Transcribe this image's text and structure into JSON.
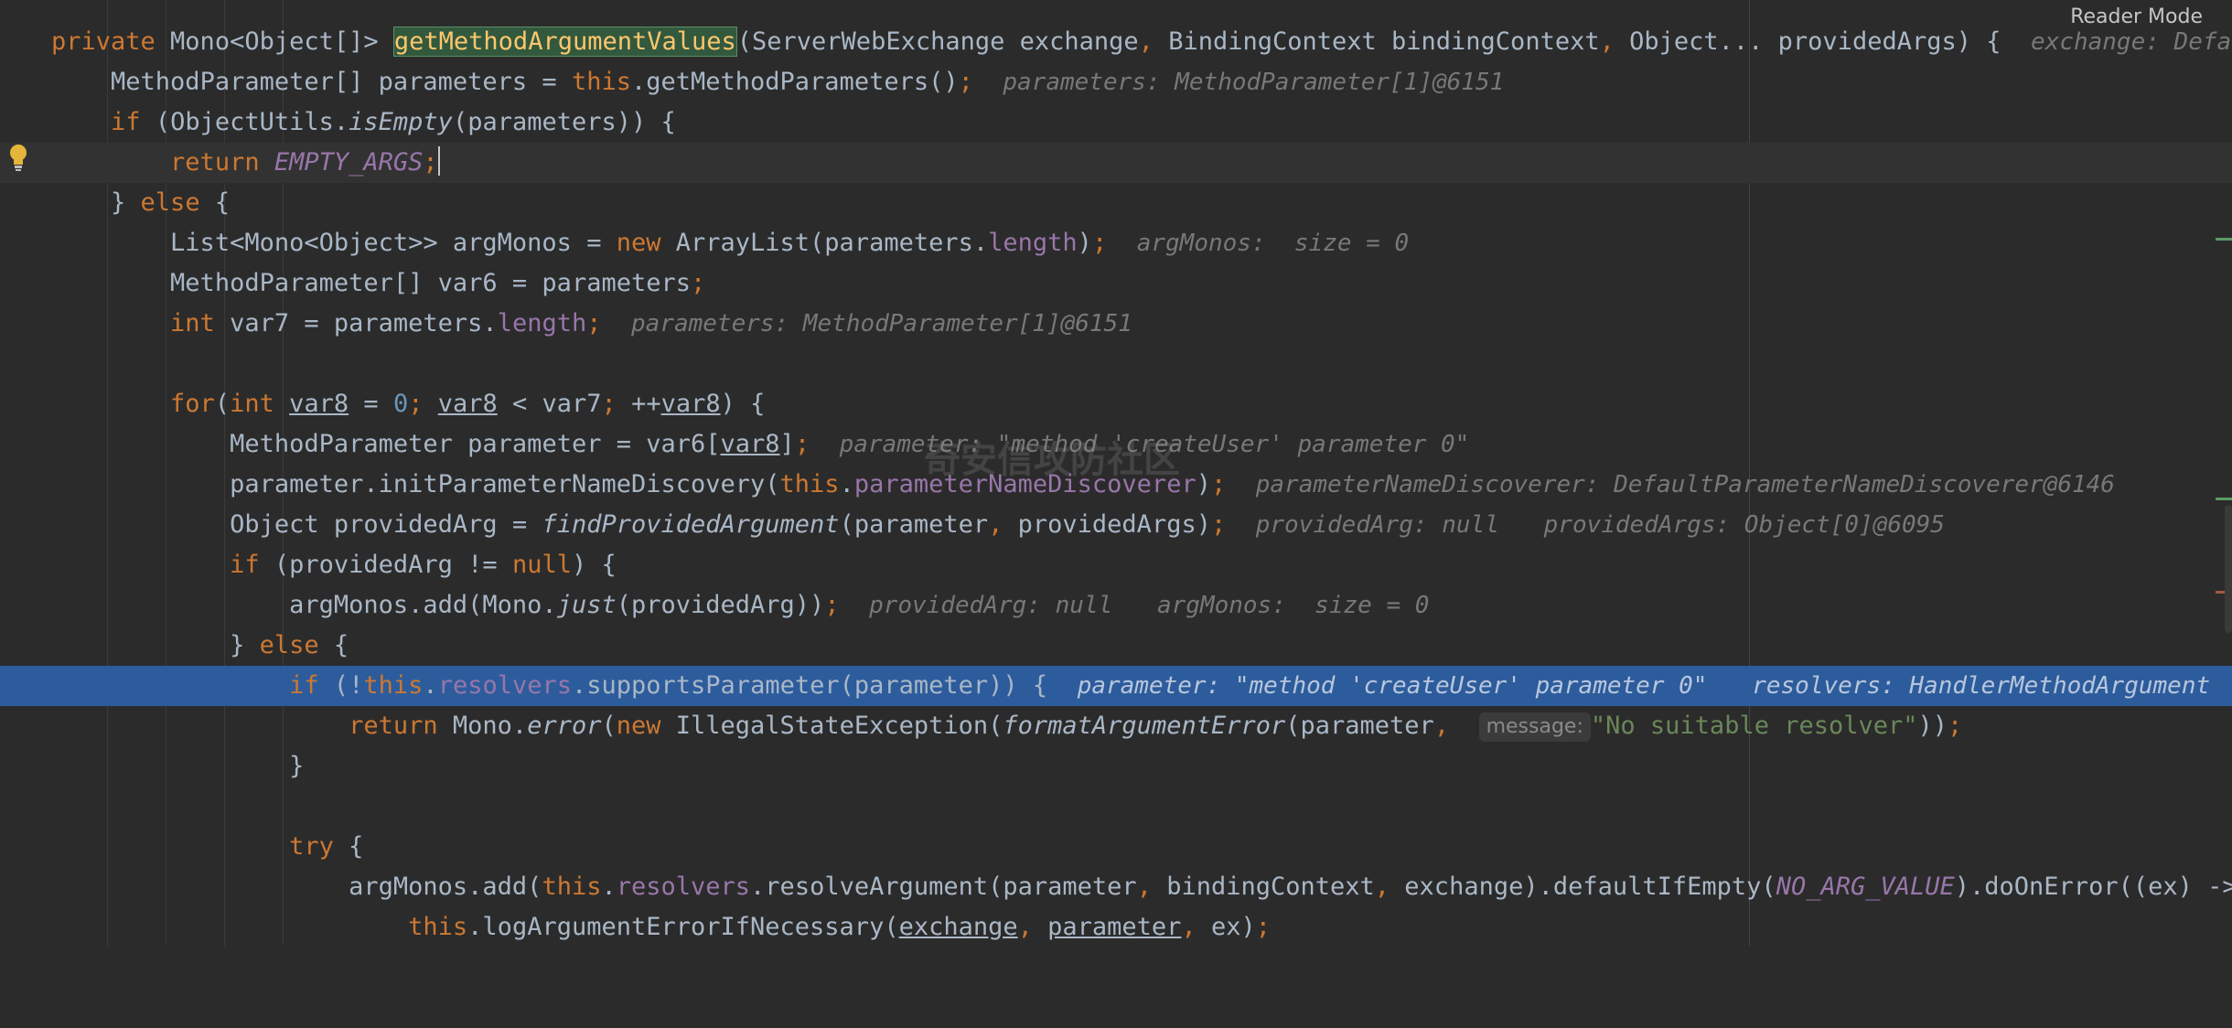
{
  "reader_mode_label": "Reader Mode",
  "watermark_text": "奇安信攻防社区",
  "colors": {
    "keyword": "#cc7832",
    "method_decl": "#ffc66d",
    "field": "#9876aa",
    "number": "#6897bb",
    "string": "#6a8759",
    "execution_line": "#2d5c9c",
    "hint": "#787878"
  },
  "l1": {
    "a": "private ",
    "b": "Mono<Object[]> ",
    "c": "getMethodArgumentValues",
    "d": "(ServerWebExchange exchange",
    "e": ", ",
    "f": "BindingContext bindingContext",
    "g": ", ",
    "h": "Object... providedArgs) {",
    "hint": "exchange: Default"
  },
  "l2": {
    "a": "MethodParameter[] parameters = ",
    "b": "this",
    "c": ".getMethodParameters()",
    "d": ";",
    "hint": "parameters: MethodParameter[1]@6151"
  },
  "l3": {
    "a": "if ",
    "b": "(ObjectUtils.",
    "c": "isEmpty",
    "d": "(parameters)) {"
  },
  "l4": {
    "a": "return ",
    "b": "EMPTY_ARGS",
    "c": ";"
  },
  "l5": {
    "a": "} ",
    "b": "else ",
    "c": "{"
  },
  "l6": {
    "a": "List<Mono<Object>> argMonos = ",
    "b": "new ",
    "c": "ArrayList(parameters.",
    "d": "length",
    "e": ")",
    "f": ";",
    "hint": "argMonos:  size = 0"
  },
  "l7": {
    "a": "MethodParameter[] var6 = parameters",
    "b": ";"
  },
  "l8": {
    "a": "int ",
    "b": "var7 = parameters.",
    "c": "length",
    "d": ";",
    "hint": "parameters: MethodParameter[1]@6151"
  },
  "l10": {
    "a": "for",
    "b": "(",
    "c": "int ",
    "d": "var8",
    "e": " = ",
    "f": "0",
    "g": "; ",
    "h": "var8",
    "i": " < var7",
    "j": "; ",
    "k": "++",
    "l": "var8",
    "m": ") {"
  },
  "l11": {
    "a": "MethodParameter parameter = var6[",
    "b": "var8",
    "c": "]",
    "d": ";",
    "hint": "parameter: \"method 'createUser' parameter 0\""
  },
  "l12": {
    "a": "parameter.initParameterNameDiscovery(",
    "b": "this",
    "c": ".",
    "d": "parameterNameDiscoverer",
    "e": ")",
    "f": ";",
    "hint": "parameterNameDiscoverer: DefaultParameterNameDiscoverer@6146"
  },
  "l13": {
    "a": "Object providedArg = ",
    "b": "findProvidedArgument",
    "c": "(parameter",
    "d": ", ",
    "e": "providedArgs)",
    "f": ";",
    "hint1": "providedArg: null",
    "hint2": "providedArgs: Object[0]@6095"
  },
  "l14": {
    "a": "if ",
    "b": "(providedArg != ",
    "c": "null",
    "d": ") {"
  },
  "l15": {
    "a": "argMonos.add(Mono.",
    "b": "just",
    "c": "(providedArg))",
    "d": ";",
    "hint1": "providedArg: null",
    "hint2": "argMonos:  size = 0"
  },
  "l16": {
    "a": "} ",
    "b": "else ",
    "c": "{"
  },
  "l17": {
    "a": "if ",
    "b": "(!",
    "c": "this",
    "d": ".",
    "e": "resolvers",
    "f": ".supportsParameter(parameter)) {",
    "hint1": "parameter: \"method 'createUser' parameter 0\"",
    "hint2": "resolvers: HandlerMethodArgument"
  },
  "l18": {
    "a": "return ",
    "b": "Mono.",
    "c": "error",
    "d": "(",
    "e": "new ",
    "f": "IllegalStateException(",
    "g": "formatArgumentError",
    "h": "(parameter",
    "i": ", ",
    "param_hint": "message:",
    "j": "\"No suitable resolver\"",
    "k": "))",
    "l": ";"
  },
  "l19": {
    "a": "}"
  },
  "l21": {
    "a": "try ",
    "b": "{"
  },
  "l22": {
    "a": "argMonos.add(",
    "b": "this",
    "c": ".",
    "d": "resolvers",
    "e": ".resolveArgument(parameter",
    "f": ", ",
    "g": "bindingContext",
    "h": ", ",
    "i": "exchange).defaultIfEmpty(",
    "j": "NO_ARG_VALUE",
    "k": ").doOnError((ex) -> {"
  },
  "l23": {
    "a": "this",
    "b": ".logArgumentErrorIfNecessary(",
    "c": "exchange",
    "d": ", ",
    "e": "parameter",
    "f": ", ",
    "g": "ex)",
    "h": ";"
  }
}
